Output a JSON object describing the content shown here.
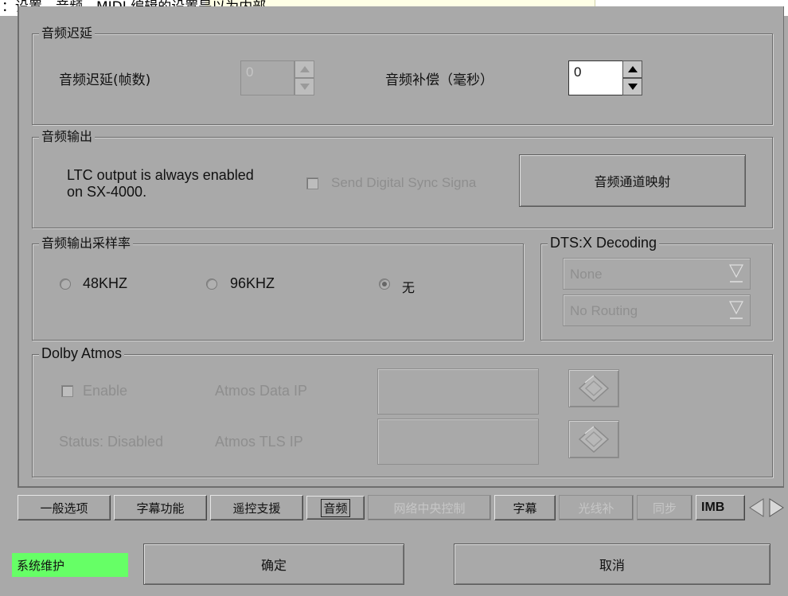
{
  "top_strip": {
    "text": "：设置，音频，MIDI 编辑的设置是以为内部。"
  },
  "audio_delay": {
    "group_title": "音频迟延",
    "frames_label": "音频迟延(帧数)",
    "frames_value": "0",
    "comp_label": "音频补偿（毫秒）",
    "comp_value": "0"
  },
  "audio_output": {
    "group_title": "音频输出",
    "ltc_line1": "LTC output is always enabled",
    "ltc_line2": "on SX-4000.",
    "sync_checkbox_label": "Send Digital Sync Signa",
    "channel_map_button": "音频通道映射"
  },
  "sample_rate": {
    "group_title": "音频输出采样率",
    "options": [
      {
        "label": "48KHZ",
        "selected": false
      },
      {
        "label": "96KHZ",
        "selected": false
      },
      {
        "label": "无",
        "selected": true
      }
    ]
  },
  "dtsx": {
    "group_title": "DTS:X Decoding",
    "select1": "None",
    "select2": "No Routing"
  },
  "dolby_atmos": {
    "group_title": "Dolby Atmos",
    "enable_label": "Enable",
    "status_label": "Status: Disabled",
    "data_ip_label": "Atmos Data IP",
    "tls_ip_label": "Atmos TLS IP",
    "data_ip_value": "",
    "tls_ip_value": ""
  },
  "tabs": [
    {
      "label": "一般选项",
      "disabled": false
    },
    {
      "label": "字幕功能",
      "disabled": false
    },
    {
      "label": "遥控支援",
      "disabled": false
    },
    {
      "label": "音频",
      "disabled": false,
      "active": true
    },
    {
      "label": "网络中央控制",
      "disabled": true
    },
    {
      "label": "字幕",
      "disabled": false
    },
    {
      "label": "光线补",
      "disabled": true
    },
    {
      "label": "同步",
      "disabled": true
    },
    {
      "label": "IMB",
      "disabled": false
    }
  ],
  "footer": {
    "maintenance_badge": "系统维护",
    "ok_button": "确定",
    "cancel_button": "取消"
  },
  "colors": {
    "background": "#a9a9a9",
    "badge": "#66ff66",
    "disabled_text": "#8e8e8e"
  },
  "icons": [
    "spin-up-icon",
    "spin-down-icon",
    "select-arrow-icon",
    "diamond-icon",
    "tab-prev-icon",
    "tab-next-icon"
  ]
}
